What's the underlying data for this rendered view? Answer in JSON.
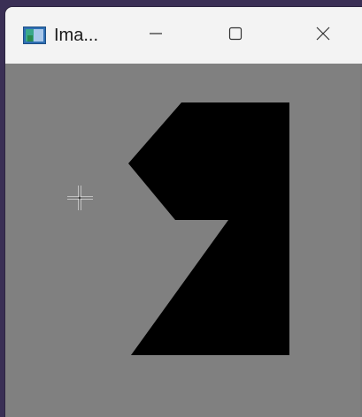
{
  "window": {
    "title": "Ima...",
    "controls": {
      "minimize_icon": "minimize-icon",
      "maximize_icon": "maximize-icon",
      "close_icon": "close-icon"
    }
  },
  "canvas": {
    "background_color": "#808080",
    "shape_color": "#000000",
    "cursor_icon": "crosshair-cursor-icon"
  },
  "colors": {
    "titlebar_bg": "#f3f3f3",
    "title_text": "#1a1a1a",
    "canvas_bg": "#808080"
  }
}
